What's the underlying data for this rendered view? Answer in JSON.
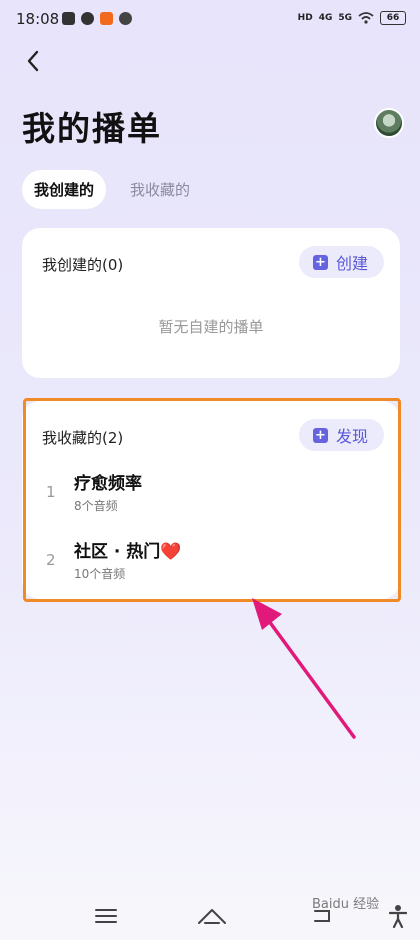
{
  "status_bar": {
    "time": "18:08",
    "net1": "4G",
    "net2": "5G",
    "hd": "HD",
    "battery": "66"
  },
  "page": {
    "title": "我的播单"
  },
  "tabs": [
    {
      "label": "我创建的",
      "active": true
    },
    {
      "label": "我收藏的",
      "active": false
    }
  ],
  "created_section": {
    "title": "我创建的(0)",
    "action_label": "创建",
    "empty_text": "暂无自建的播单"
  },
  "favorites_section": {
    "title": "我收藏的(2)",
    "action_label": "发现",
    "items": [
      {
        "index": "1",
        "name": "疗愈频率",
        "count": "8个音频"
      },
      {
        "index": "2",
        "name": "社区 · 热门",
        "emoji": "❤️",
        "count": "10个音频"
      }
    ]
  },
  "colors": {
    "accent": "#5a58d6",
    "highlight_border": "#f08a24",
    "annotation_arrow": "#e0197a"
  },
  "watermark": "Baidu 经验"
}
